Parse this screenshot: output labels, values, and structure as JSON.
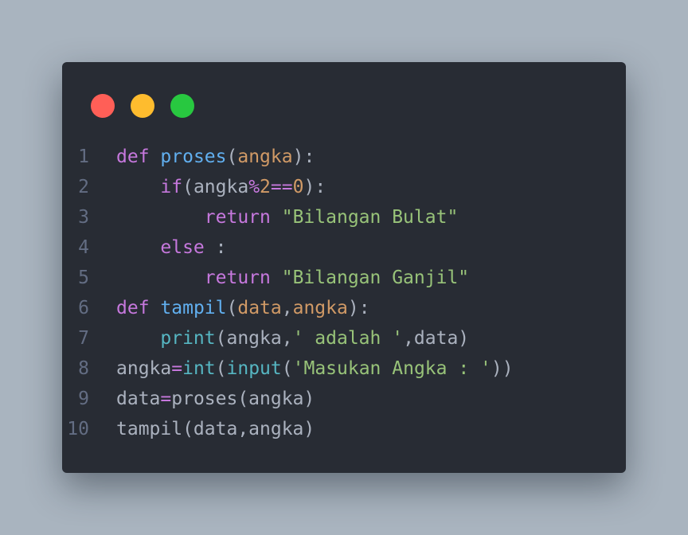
{
  "window": {
    "controls": [
      {
        "name": "close",
        "color": "#ff5f57"
      },
      {
        "name": "minimize",
        "color": "#febc2e"
      },
      {
        "name": "maximize",
        "color": "#28c840"
      }
    ]
  },
  "code": {
    "lines": [
      {
        "number": "1",
        "tokens": [
          {
            "text": "def",
            "type": "kw"
          },
          {
            "text": " ",
            "type": "plain"
          },
          {
            "text": "proses",
            "type": "fn"
          },
          {
            "text": "(",
            "type": "plain"
          },
          {
            "text": "angka",
            "type": "param"
          },
          {
            "text": "):",
            "type": "plain"
          }
        ]
      },
      {
        "number": "2",
        "tokens": [
          {
            "text": "    ",
            "type": "plain"
          },
          {
            "text": "if",
            "type": "kw"
          },
          {
            "text": "(angka",
            "type": "plain"
          },
          {
            "text": "%",
            "type": "op"
          },
          {
            "text": "2",
            "type": "num"
          },
          {
            "text": "==",
            "type": "op"
          },
          {
            "text": "0",
            "type": "num"
          },
          {
            "text": "):",
            "type": "plain"
          }
        ]
      },
      {
        "number": "3",
        "tokens": [
          {
            "text": "        ",
            "type": "plain"
          },
          {
            "text": "return",
            "type": "kw"
          },
          {
            "text": " ",
            "type": "plain"
          },
          {
            "text": "\"Bilangan Bulat\"",
            "type": "str"
          }
        ]
      },
      {
        "number": "4",
        "tokens": [
          {
            "text": "    ",
            "type": "plain"
          },
          {
            "text": "else",
            "type": "kw"
          },
          {
            "text": " :",
            "type": "plain"
          }
        ]
      },
      {
        "number": "5",
        "tokens": [
          {
            "text": "        ",
            "type": "plain"
          },
          {
            "text": "return",
            "type": "kw"
          },
          {
            "text": " ",
            "type": "plain"
          },
          {
            "text": "\"Bilangan Ganjil\"",
            "type": "str"
          }
        ]
      },
      {
        "number": "6",
        "tokens": [
          {
            "text": "def",
            "type": "kw"
          },
          {
            "text": " ",
            "type": "plain"
          },
          {
            "text": "tampil",
            "type": "fn"
          },
          {
            "text": "(",
            "type": "plain"
          },
          {
            "text": "data",
            "type": "param"
          },
          {
            "text": ",",
            "type": "plain"
          },
          {
            "text": "angka",
            "type": "param"
          },
          {
            "text": "):",
            "type": "plain"
          }
        ]
      },
      {
        "number": "7",
        "tokens": [
          {
            "text": "    ",
            "type": "plain"
          },
          {
            "text": "print",
            "type": "builtin"
          },
          {
            "text": "(angka,",
            "type": "plain"
          },
          {
            "text": "' adalah '",
            "type": "str"
          },
          {
            "text": ",data)",
            "type": "plain"
          }
        ]
      },
      {
        "number": "8",
        "tokens": [
          {
            "text": "angka",
            "type": "plain"
          },
          {
            "text": "=",
            "type": "op"
          },
          {
            "text": "int",
            "type": "builtin"
          },
          {
            "text": "(",
            "type": "plain"
          },
          {
            "text": "input",
            "type": "builtin"
          },
          {
            "text": "(",
            "type": "plain"
          },
          {
            "text": "'Masukan Angka : '",
            "type": "str"
          },
          {
            "text": "))",
            "type": "plain"
          }
        ]
      },
      {
        "number": "9",
        "tokens": [
          {
            "text": "data",
            "type": "plain"
          },
          {
            "text": "=",
            "type": "op"
          },
          {
            "text": "proses(angka)",
            "type": "plain"
          }
        ]
      },
      {
        "number": "10",
        "tokens": [
          {
            "text": "tampil(data,angka)",
            "type": "plain"
          }
        ]
      }
    ]
  }
}
